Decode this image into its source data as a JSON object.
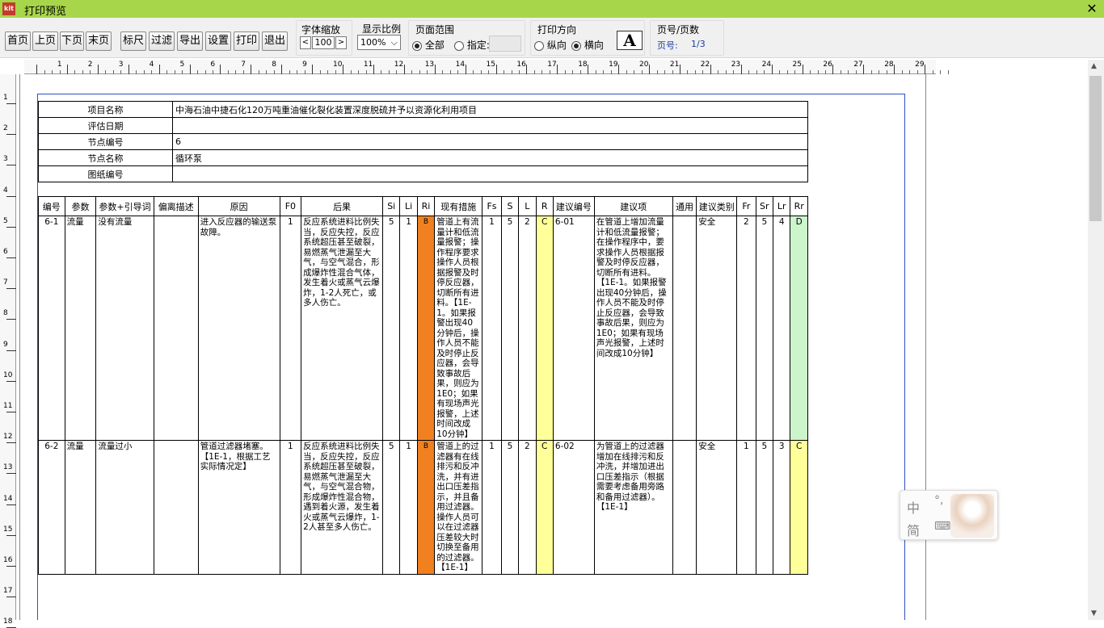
{
  "window": {
    "title": "打印预览",
    "app_icon": "kit"
  },
  "toolbar": {
    "first": "首页",
    "prev": "上页",
    "next": "下页",
    "last": "末页",
    "ruler": "标尺",
    "filter": "过滤",
    "export": "导出",
    "settings": "设置",
    "print": "打印",
    "exit": "退出",
    "font_zoom_label": "字体缩放",
    "font_zoom_value": "100",
    "display_ratio_label": "显示比例",
    "display_ratio_value": "100%",
    "page_range_label": "页面范围",
    "all": "全部",
    "specify": "指定:",
    "orientation_label": "打印方向",
    "portrait": "纵向",
    "landscape": "横向",
    "page_count_label": "页号/页数",
    "page_no_label": "页号:",
    "page_no_value": "1/3"
  },
  "info": [
    {
      "k": "项目名称",
      "v": "中海石油中捷石化120万吨重油催化裂化装置深度脱硫并予以资源化利用项目"
    },
    {
      "k": "评估日期",
      "v": ""
    },
    {
      "k": "节点编号",
      "v": "6"
    },
    {
      "k": "节点名称",
      "v": "循环泵"
    },
    {
      "k": "图纸编号",
      "v": ""
    }
  ],
  "headers": [
    "编号",
    "参数",
    "参数+引导词",
    "偏离描述",
    "原因",
    "F0",
    "后果",
    "Si",
    "Li",
    "Ri",
    "现有措施",
    "Fs",
    "S",
    "L",
    "R",
    "建议编号",
    "建议项",
    "通用",
    "建议类别",
    "Fr",
    "Sr",
    "Lr",
    "Rr"
  ],
  "rows": [
    {
      "no": "6-1",
      "param": "流量",
      "guide": "没有流量",
      "dev": "",
      "cause": "进入反应器的输送泵故障。",
      "f0": "1",
      "cons": "反应系统进料比例失当，反应失控，反应系统超压甚至破裂，易燃蒸气泄漏至大气，与空气混合，形成爆炸性混合气体，发生着火或蒸气云爆炸，1-2人死亡，或多人伤亡。",
      "si": "5",
      "li": "1",
      "ri": "B",
      "meas": "管道上有流量计和低流量报警；操作程序要求操作人员根据报警及时停反应器，切断所有进料。【1E-1。如果报警出现40分钟后，操作人员不能及时停止反应器，会导致事故后果，则应为1E0；如果有现场声光报警，上述时间改成10分钟】",
      "fs": "1",
      "s": "5",
      "l": "2",
      "r": "C",
      "sno": "6-01",
      "sug": "在管道上增加流量计和低流量报警；在操作程序中，要求操作人员根据报警及时停反应器，切断所有进料。【1E-1。如果报警出现40分钟后，操作人员不能及时停止反应器，会导致事故后果，则应为1E0；如果有现场声光报警，上述时间改成10分钟】",
      "gen": "",
      "cat": "安全",
      "fr": "2",
      "sr": "5",
      "lr": "4",
      "rr": "D"
    },
    {
      "no": "6-2",
      "param": "流量",
      "guide": "流量过小",
      "dev": "",
      "cause": "管道过滤器堵塞。【1E-1，根据工艺实际情况定】",
      "f0": "1",
      "cons": "反应系统进料比例失当，反应失控，反应系统超压甚至破裂，易燃蒸气泄漏至大气，与空气混合物，形成爆炸性混合物，遇到着火源，发生着火或蒸气云爆炸，1-2人甚至多人伤亡。",
      "si": "5",
      "li": "1",
      "ri": "B",
      "meas": "管道上的过滤器有在线排污和反冲洗，并有进出口压差指示，并且备用过滤器。操作人员可以在过滤器压差较大时切换至备用的过滤器。【1E-1】",
      "fs": "1",
      "s": "5",
      "l": "2",
      "r": "C",
      "sno": "6-02",
      "sug": "为管道上的过滤器增加在线排污和反冲洗，并增加进出口压差指示（根据需要考虑备用旁路和备用过滤器）。【1E-1】",
      "gen": "",
      "cat": "安全",
      "fr": "1",
      "sr": "5",
      "lr": "3",
      "rr": "C"
    }
  ],
  "ime": {
    "lang": "中",
    "punct": "°,",
    "mode": "简",
    "keyboard": "⌨"
  }
}
